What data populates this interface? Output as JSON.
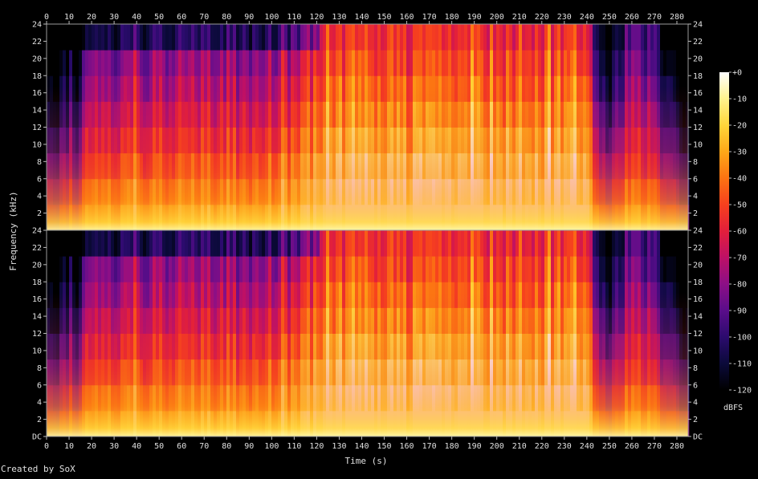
{
  "chart_data": {
    "type": "heatmap",
    "title": "",
    "xlabel": "Time (s)",
    "ylabel": "Frequency (kHz)",
    "xlim": [
      0,
      285
    ],
    "ylim": [
      0,
      24
    ],
    "x_ticks": [
      0,
      10,
      20,
      30,
      40,
      50,
      60,
      70,
      80,
      90,
      100,
      110,
      120,
      130,
      140,
      150,
      160,
      170,
      180,
      190,
      200,
      210,
      220,
      230,
      240,
      250,
      260,
      270,
      280
    ],
    "y_ticks": [
      {
        "value": 0,
        "label": "DC"
      },
      {
        "value": 2,
        "label": "2"
      },
      {
        "value": 4,
        "label": "4"
      },
      {
        "value": 6,
        "label": "6"
      },
      {
        "value": 8,
        "label": "8"
      },
      {
        "value": 10,
        "label": "10"
      },
      {
        "value": 12,
        "label": "12"
      },
      {
        "value": 14,
        "label": "14"
      },
      {
        "value": 16,
        "label": "16"
      },
      {
        "value": 18,
        "label": "18"
      },
      {
        "value": 20,
        "label": "20"
      },
      {
        "value": 22,
        "label": "22"
      },
      {
        "value": 24,
        "label": "24"
      }
    ],
    "channels": 2,
    "colorbar": {
      "label": "dBFS",
      "range": [
        -120,
        0
      ],
      "ticks": [
        {
          "value": 0,
          "label": "+0"
        },
        {
          "value": -10,
          "label": "-10"
        },
        {
          "value": -20,
          "label": "-20"
        },
        {
          "value": -30,
          "label": "-30"
        },
        {
          "value": -40,
          "label": "-40"
        },
        {
          "value": -50,
          "label": "-50"
        },
        {
          "value": -60,
          "label": "-60"
        },
        {
          "value": -70,
          "label": "-70"
        },
        {
          "value": -80,
          "label": "-80"
        },
        {
          "value": -90,
          "label": "-90"
        },
        {
          "value": -100,
          "label": "-100"
        },
        {
          "value": -110,
          "label": "-110"
        },
        {
          "value": -120,
          "label": "-120"
        }
      ],
      "colors": [
        "#000000",
        "#0b0a3a",
        "#2c0b6e",
        "#5a0d8a",
        "#8c0f86",
        "#bd1066",
        "#e21f3b",
        "#f6401e",
        "#fc7312",
        "#fea818",
        "#ffd63a",
        "#fff38e",
        "#ffffff"
      ]
    },
    "energy_envelope": {
      "description_free": true,
      "time_s": [
        0,
        5,
        15,
        17,
        30,
        50,
        70,
        90,
        110,
        121,
        140,
        160,
        180,
        200,
        220,
        240,
        245,
        250,
        255,
        258,
        265,
        270,
        275,
        280,
        285
      ],
      "high_freq_level": [
        0.15,
        0.2,
        0.25,
        0.5,
        0.55,
        0.55,
        0.6,
        0.55,
        0.6,
        0.78,
        0.82,
        0.8,
        0.8,
        0.8,
        0.8,
        0.75,
        0.4,
        0.3,
        0.35,
        0.55,
        0.5,
        0.45,
        0.3,
        0.15,
        0.05
      ]
    },
    "grid": false,
    "legend": "right"
  },
  "credit": "Created by SoX"
}
